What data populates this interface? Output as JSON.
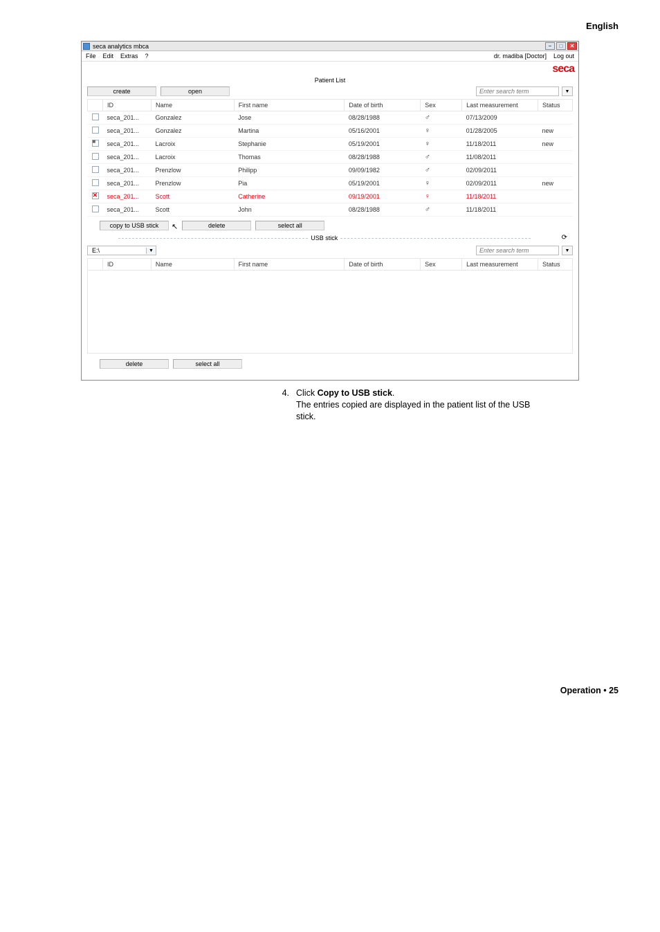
{
  "page": {
    "language_label": "English",
    "footer": "Operation • 25"
  },
  "window": {
    "title": "seca analytics mbca",
    "brand": "seca",
    "menu": {
      "file": "File",
      "edit": "Edit",
      "extras": "Extras",
      "help": "?"
    },
    "user": "dr. madiba [Doctor]",
    "logout": "Log out"
  },
  "panel1": {
    "title": "Patient List",
    "create_btn": "create",
    "open_btn": "open",
    "search_placeholder": "Enter search term",
    "copy_btn": "copy to USB stick",
    "delete_btn": "delete",
    "select_all_btn": "select all",
    "headers": {
      "id": "ID",
      "name": "Name",
      "first_name": "First name",
      "dob": "Date of birth",
      "sex": "Sex",
      "last_measurement": "Last measurement",
      "status": "Status"
    },
    "rows": [
      {
        "chk": "",
        "id": "seca_201...",
        "name": "Gonzalez",
        "first": "Jose",
        "dob": "08/28/1988",
        "sex": "♂",
        "last": "07/13/2009",
        "status": ""
      },
      {
        "chk": "",
        "id": "seca_201...",
        "name": "Gonzalez",
        "first": "Martina",
        "dob": "05/16/2001",
        "sex": "♀",
        "last": "01/28/2005",
        "status": "new"
      },
      {
        "chk": "checked",
        "id": "seca_201...",
        "name": "Lacroix",
        "first": "Stephanie",
        "dob": "05/19/2001",
        "sex": "♀",
        "last": "11/18/2011",
        "status": "new"
      },
      {
        "chk": "",
        "id": "seca_201...",
        "name": "Lacroix",
        "first": "Thomas",
        "dob": "08/28/1988",
        "sex": "♂",
        "last": "11/08/2011",
        "status": ""
      },
      {
        "chk": "",
        "id": "seca_201...",
        "name": "Prenzlow",
        "first": "Philipp",
        "dob": "09/09/1982",
        "sex": "♂",
        "last": "02/09/2011",
        "status": ""
      },
      {
        "chk": "",
        "id": "seca_201...",
        "name": "Prenzlow",
        "first": "Pia",
        "dob": "05/19/2001",
        "sex": "♀",
        "last": "02/09/2011",
        "status": "new"
      },
      {
        "chk": "checked-red",
        "id": "seca_201...",
        "name": "Scott",
        "first": "Catherine",
        "dob": "09/19/2001",
        "sex": "♀",
        "last": "11/18/2011",
        "status": "",
        "highlight": true
      },
      {
        "chk": "",
        "id": "seca_201...",
        "name": "Scott",
        "first": "John",
        "dob": "08/28/1988",
        "sex": "♂",
        "last": "11/18/2011",
        "status": ""
      }
    ]
  },
  "panel2": {
    "title": "USB stick",
    "drive": "E:\\",
    "delete_btn": "delete",
    "select_all_btn": "select all",
    "search_placeholder": "Enter search term",
    "headers": {
      "id": "ID",
      "name": "Name",
      "first_name": "First name",
      "dob": "Date of birth",
      "sex": "Sex",
      "last_measurement": "Last measurement",
      "status": "Status"
    }
  },
  "instruction": {
    "number": "4.",
    "click": "Click ",
    "bold": "Copy to USB stick",
    "period": ".",
    "body": "The entries copied are displayed in the patient list of the USB stick."
  }
}
